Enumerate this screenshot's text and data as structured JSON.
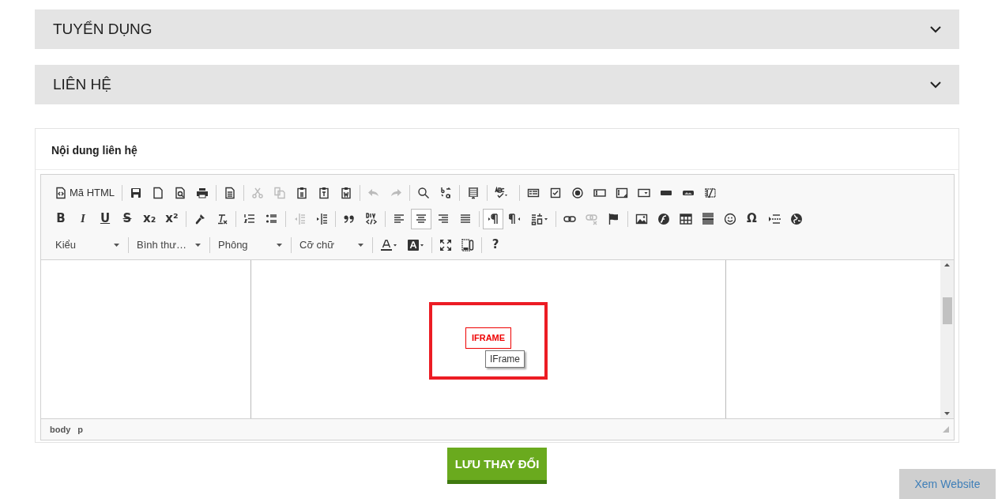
{
  "sections": [
    {
      "title": "TUYỂN DỤNG",
      "expanded": false
    },
    {
      "title": "LIÊN HỆ",
      "expanded": false
    }
  ],
  "editor": {
    "title": "Nội dung liên hệ",
    "toolbar": {
      "rows": [
        {
          "groups": [
            {
              "buttons": [
                {
                  "kind": "text",
                  "label": "Mã HTML"
                }
              ]
            },
            {
              "buttons": [
                {
                  "kind": "icon",
                  "disabled": false
                },
                {
                  "kind": "icon",
                  "disabled": false
                },
                {
                  "kind": "icon",
                  "disabled": false
                },
                {
                  "kind": "icon",
                  "disabled": false
                }
              ]
            },
            {
              "buttons": [
                {
                  "kind": "icon",
                  "disabled": false
                }
              ]
            },
            {
              "buttons": [
                {
                  "kind": "icon",
                  "disabled": true
                },
                {
                  "kind": "icon",
                  "disabled": true
                },
                {
                  "kind": "icon",
                  "disabled": false
                },
                {
                  "kind": "icon",
                  "disabled": false
                },
                {
                  "kind": "icon",
                  "disabled": false
                }
              ]
            },
            {
              "buttons": [
                {
                  "kind": "icon",
                  "disabled": true
                },
                {
                  "kind": "icon",
                  "disabled": true
                }
              ]
            },
            {
              "buttons": [
                {
                  "kind": "icon",
                  "disabled": false
                },
                {
                  "kind": "icon",
                  "disabled": false
                }
              ]
            },
            {
              "buttons": [
                {
                  "kind": "icon",
                  "disabled": false
                }
              ]
            },
            {
              "buttons": [
                {
                  "kind": "icon",
                  "disabled": false
                }
              ]
            },
            {
              "buttons": [
                {
                  "kind": "icon",
                  "disabled": false
                },
                {
                  "kind": "icon",
                  "disabled": false
                },
                {
                  "kind": "icon",
                  "disabled": false
                },
                {
                  "kind": "icon",
                  "disabled": false
                },
                {
                  "kind": "icon",
                  "disabled": false
                },
                {
                  "kind": "icon",
                  "disabled": false
                },
                {
                  "kind": "icon",
                  "disabled": false
                },
                {
                  "kind": "icon",
                  "disabled": false
                },
                {
                  "kind": "icon",
                  "disabled": false
                }
              ]
            }
          ]
        },
        {
          "groups": [
            {
              "buttons": [
                {
                  "kind": "glyph",
                  "glyph": "B",
                  "disabled": false,
                  "selected": false
                },
                {
                  "kind": "glyph",
                  "glyph": "I",
                  "disabled": false,
                  "selected": false
                },
                {
                  "kind": "glyph",
                  "glyph": "U",
                  "disabled": false,
                  "selected": false
                },
                {
                  "kind": "glyph",
                  "glyph": "S",
                  "disabled": false,
                  "selected": false
                },
                {
                  "kind": "glyph",
                  "glyph": "x₂",
                  "disabled": false,
                  "selected": false
                },
                {
                  "kind": "glyph",
                  "glyph": "x²",
                  "disabled": false,
                  "selected": false
                }
              ]
            },
            {
              "buttons": [
                {
                  "kind": "icon",
                  "disabled": false,
                  "selected": false
                },
                {
                  "kind": "icon",
                  "disabled": false,
                  "selected": false
                }
              ]
            },
            {
              "buttons": [
                {
                  "kind": "icon",
                  "disabled": false,
                  "selected": false
                },
                {
                  "kind": "icon",
                  "disabled": false,
                  "selected": false
                }
              ]
            },
            {
              "buttons": [
                {
                  "kind": "icon",
                  "disabled": true,
                  "selected": false
                },
                {
                  "kind": "icon",
                  "disabled": false,
                  "selected": false
                }
              ]
            },
            {
              "buttons": [
                {
                  "kind": "icon",
                  "disabled": false,
                  "selected": false
                },
                {
                  "kind": "icon",
                  "disabled": false,
                  "selected": false
                }
              ]
            },
            {
              "buttons": [
                {
                  "kind": "icon",
                  "disabled": false,
                  "selected": false
                },
                {
                  "kind": "icon",
                  "disabled": false,
                  "selected": true
                },
                {
                  "kind": "icon",
                  "disabled": false,
                  "selected": false
                },
                {
                  "kind": "icon",
                  "disabled": false,
                  "selected": false
                }
              ]
            },
            {
              "buttons": [
                {
                  "kind": "icon",
                  "disabled": false,
                  "selected": true
                },
                {
                  "kind": "icon",
                  "disabled": false,
                  "selected": false
                },
                {
                  "kind": "icon",
                  "disabled": false,
                  "selected": false
                }
              ]
            },
            {
              "buttons": [
                {
                  "kind": "icon",
                  "disabled": false,
                  "selected": false
                },
                {
                  "kind": "icon",
                  "disabled": true,
                  "selected": false
                },
                {
                  "kind": "icon",
                  "disabled": false,
                  "selected": false
                }
              ]
            },
            {
              "buttons": [
                {
                  "kind": "icon",
                  "disabled": false,
                  "selected": false
                },
                {
                  "kind": "icon",
                  "disabled": false,
                  "selected": false
                },
                {
                  "kind": "icon",
                  "disabled": false,
                  "selected": false
                },
                {
                  "kind": "icon",
                  "disabled": false,
                  "selected": false
                },
                {
                  "kind": "icon",
                  "disabled": false,
                  "selected": false
                },
                {
                  "kind": "glyph",
                  "glyph": "Ω",
                  "disabled": false,
                  "selected": false
                },
                {
                  "kind": "icon",
                  "disabled": false,
                  "selected": false
                },
                {
                  "kind": "icon",
                  "disabled": false,
                  "selected": false
                }
              ]
            }
          ]
        },
        {
          "groups": [
            {
              "buttons": [
                {
                  "kind": "combo",
                  "label": "Kiểu"
                }
              ]
            },
            {
              "buttons": [
                {
                  "kind": "combo",
                  "label": "Bình thư…"
                }
              ]
            },
            {
              "buttons": [
                {
                  "kind": "combo",
                  "label": "Phông"
                }
              ]
            },
            {
              "buttons": [
                {
                  "kind": "combo",
                  "label": "Cỡ chữ"
                }
              ]
            },
            {
              "buttons": [
                {
                  "kind": "icon",
                  "disabled": false
                },
                {
                  "kind": "icon",
                  "disabled": false
                }
              ]
            },
            {
              "buttons": [
                {
                  "kind": "icon",
                  "disabled": false
                },
                {
                  "kind": "icon",
                  "disabled": false
                }
              ]
            },
            {
              "buttons": [
                {
                  "kind": "glyph",
                  "glyph": "?",
                  "disabled": false
                }
              ]
            }
          ]
        }
      ]
    },
    "content": {
      "placeholder_label": "IFRAME",
      "tooltip": "IFrame"
    },
    "path": [
      "body",
      "p"
    ]
  },
  "save_button": "LƯU THAY ĐỔI",
  "view_site_button": "Xem Website"
}
